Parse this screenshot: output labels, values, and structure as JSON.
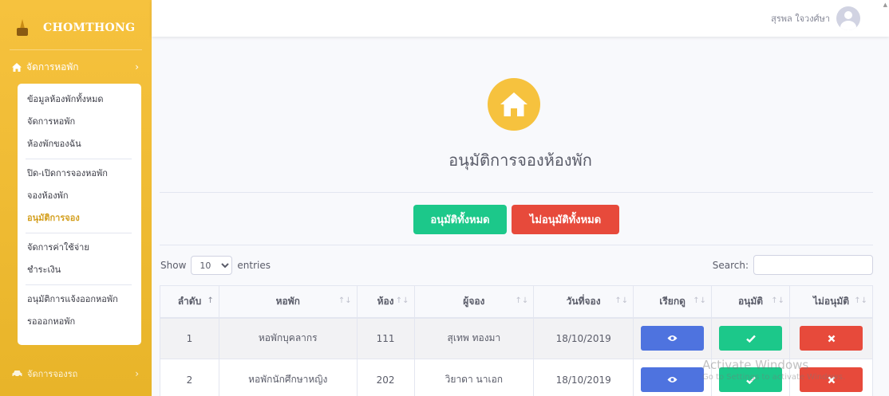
{
  "brand": {
    "name": "CHOMTHONG"
  },
  "sidebar": {
    "section_label": "จัดการหอพัก",
    "items": [
      {
        "label": "ข้อมูลห้องพักทั้งหมด",
        "active": false
      },
      {
        "label": "จัดการหอพัก",
        "active": false
      },
      {
        "label": "ห้องพักของฉัน",
        "active": false
      },
      {
        "label": "ปิด-เปิดการจองหอพัก",
        "active": false
      },
      {
        "label": "จองห้องพัก",
        "active": false
      },
      {
        "label": "อนุมัติการจอง",
        "active": true
      },
      {
        "label": "จัดการค่าใช้จ่าย",
        "active": false
      },
      {
        "label": "ชำระเงิน",
        "active": false
      },
      {
        "label": "อนุมัติการแจ้งออกหอพัก",
        "active": false
      },
      {
        "label": "รอออกหอพัก",
        "active": false
      }
    ],
    "next_section_label": "จัดการจองรถ"
  },
  "topbar": {
    "user_name": "สุรพล ใจวงศ์ษา"
  },
  "page": {
    "title": "อนุมัติการจองห้องพัก",
    "approve_all_label": "อนุมัติทั้งหมด",
    "reject_all_label": "ไม่อนุมัติทั้งหมด"
  },
  "table_controls": {
    "show_label": "Show",
    "entries_value": "10",
    "entries_label": "entries",
    "search_label": "Search:"
  },
  "table": {
    "headers": [
      "ลำดับ",
      "หอพัก",
      "ห้อง",
      "ผู้จอง",
      "วันที่จอง",
      "เรียกดู",
      "อนุมัติ",
      "ไม่อนุมัติ"
    ],
    "rows": [
      {
        "no": "1",
        "dorm": "หอพักบุคลากร",
        "room": "111",
        "booker": "สุเทพ ทองมา",
        "date": "18/10/2019"
      },
      {
        "no": "2",
        "dorm": "หอพักนักศึกษาหญิง",
        "room": "202",
        "booker": "วิยาดา นาเอก",
        "date": "18/10/2019"
      }
    ]
  },
  "watermark": {
    "line1": "Activate Windows",
    "line2": "Go to Settings to activate Windows."
  },
  "colors": {
    "sidebar": "#f6c23e",
    "approve": "#1cc88a",
    "reject": "#e74a3b",
    "view": "#4e73df"
  },
  "icons": {
    "brand": "temple-logo",
    "section": "home-icon",
    "view": "eye-icon",
    "approve": "check-icon",
    "reject": "times-icon",
    "next_section": "car-icon"
  }
}
